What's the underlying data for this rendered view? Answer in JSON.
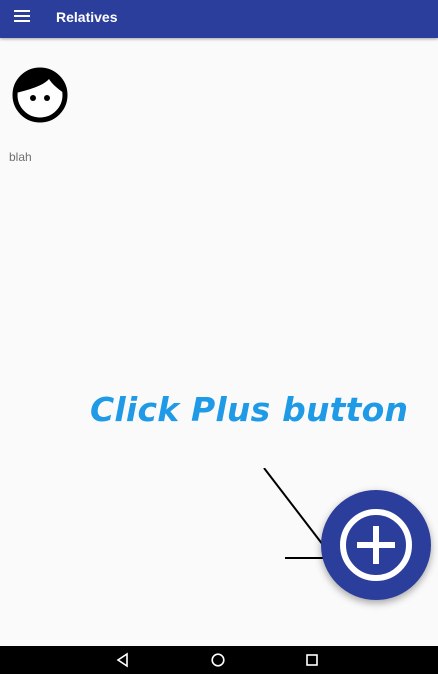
{
  "app_bar": {
    "title": "Relatives",
    "menu_icon": "hamburger-menu-icon",
    "color": "#2c3e9c"
  },
  "relatives": [
    {
      "name": "blah",
      "avatar_icon": "face-icon"
    }
  ],
  "hint": {
    "text": "Click Plus button",
    "color": "#1e9ae6",
    "arrow_icon": "arrow-icon"
  },
  "fab": {
    "icon": "add-circle-icon",
    "color": "#2c3e9c"
  },
  "nav_bar": {
    "buttons": [
      "back-icon",
      "home-icon",
      "recents-icon"
    ]
  }
}
